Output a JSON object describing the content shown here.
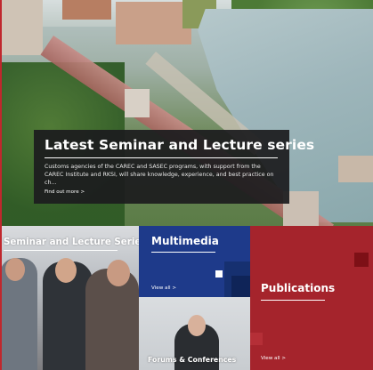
{
  "feature": {
    "title": "Latest Seminar and Lecture series",
    "description": "Customs agencies of the CAREC and SASEC programs, with support from the CAREC Institute and RKSI, will share knowledge, experience, and best practice on ch...",
    "link": "Find out more >"
  },
  "tiles": {
    "seminar": {
      "title": "Seminar and Lecture Series"
    },
    "multimedia": {
      "title": "Multimedia",
      "link": "View all >"
    },
    "forums": {
      "title": "Forums & Conferences"
    },
    "publications": {
      "title": "Publications",
      "link": "View all >"
    }
  },
  "colors": {
    "feature_bg": "#1c1c1e",
    "multimedia_bg": "#1e3a8a",
    "publications_bg": "#a5242c",
    "accent_red": "#c0272d"
  }
}
